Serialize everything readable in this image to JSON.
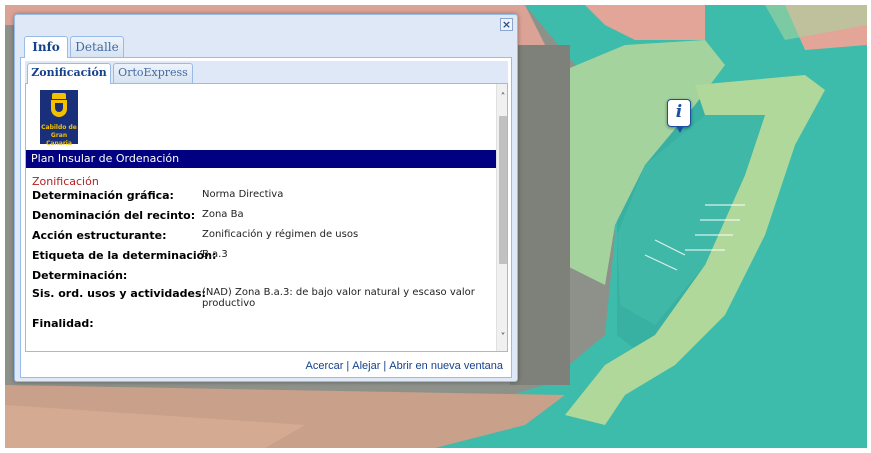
{
  "window": {
    "close_glyph": "×"
  },
  "tabs": [
    {
      "label": "Info",
      "active": true
    },
    {
      "label": "Detalle",
      "active": false
    }
  ],
  "subtabs": [
    {
      "label": "Zonificación",
      "active": true
    },
    {
      "label": "OrtoExpress",
      "active": false
    }
  ],
  "logo": {
    "line1": "Cabildo de",
    "line2": "Gran Canaria"
  },
  "plan_header": "Plan Insular de Ordenación",
  "section_title": "Zonificación",
  "rows": [
    {
      "label": "Determinación gráfica:",
      "value": "Norma Directiva"
    },
    {
      "label": "Denominación del recinto:",
      "value": "Zona Ba"
    },
    {
      "label": "Acción estructurante:",
      "value": "Zonificación y régimen de usos"
    },
    {
      "label": "Etiqueta de la determinación:",
      "value": "B.a.3"
    },
    {
      "label": "Determinación:",
      "value": ""
    },
    {
      "label": "Sis. ord. usos y actividades:",
      "value": "(NAD) Zona B.a.3: de bajo valor natural y escaso valor productivo"
    },
    {
      "label": "Finalidad:",
      "value": ""
    }
  ],
  "scroll": {
    "up_glyph": "˄",
    "down_glyph": "˅"
  },
  "footer": {
    "zoom_in": "Acercar",
    "zoom_out": "Alejar",
    "open_new": "Abrir en nueva ventana",
    "separator": "|"
  },
  "map_marker": {
    "glyph": "i"
  },
  "colors": {
    "header_bg": "#000080",
    "section_title": "#b22222",
    "link": "#15428b",
    "zone_green": "#9fcf9a",
    "zone_red": "#e8a79c",
    "sea_teal": "#3bbfae"
  }
}
